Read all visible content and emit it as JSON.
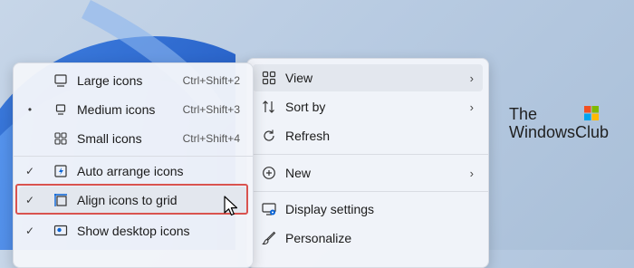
{
  "submenu": {
    "items": [
      {
        "label": "Large icons",
        "shortcut": "Ctrl+Shift+2",
        "icon": "large-icons-icon",
        "checked": false,
        "bullet": false
      },
      {
        "label": "Medium icons",
        "shortcut": "Ctrl+Shift+3",
        "icon": "medium-icons-icon",
        "checked": false,
        "bullet": true
      },
      {
        "label": "Small icons",
        "shortcut": "Ctrl+Shift+4",
        "icon": "small-icons-icon",
        "checked": false,
        "bullet": false
      },
      {
        "label": "Auto arrange icons",
        "icon": "auto-arrange-icon",
        "checked": true
      },
      {
        "label": "Align icons to grid",
        "icon": "align-grid-icon",
        "checked": true
      },
      {
        "label": "Show desktop icons",
        "icon": "show-desktop-icon",
        "checked": true
      }
    ],
    "bullet_glyph": "•",
    "check_glyph": "✓"
  },
  "mainmenu": {
    "items": [
      {
        "label": "View",
        "icon": "view-grid-icon",
        "has_submenu": true
      },
      {
        "label": "Sort by",
        "icon": "sort-icon",
        "has_submenu": true
      },
      {
        "label": "Refresh",
        "icon": "refresh-icon",
        "has_submenu": false
      },
      {
        "label": "New",
        "icon": "new-plus-icon",
        "has_submenu": true
      },
      {
        "label": "Display settings",
        "icon": "display-settings-icon",
        "has_submenu": false
      },
      {
        "label": "Personalize",
        "icon": "personalize-brush-icon",
        "has_submenu": false
      }
    ],
    "arrow_glyph": "›"
  },
  "brand": {
    "line1": "The",
    "line2": "WindowsClub"
  },
  "colors": {
    "highlight_box": "#d9534f",
    "accent": "#0a64d6"
  }
}
